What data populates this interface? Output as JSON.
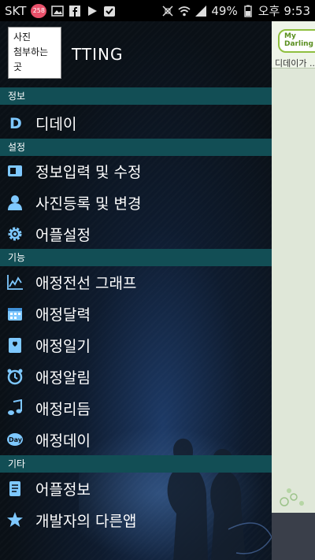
{
  "status_bar": {
    "carrier": "SKT",
    "notification_count": "258",
    "battery": "49%",
    "ampm": "오후",
    "time": "9:53"
  },
  "header": {
    "avatar_text_lines": [
      "사진",
      "첨부하는",
      "곳"
    ],
    "title": "TTING"
  },
  "sections": {
    "info": "정보",
    "settings": "설정",
    "features": "기능",
    "etc": "기타"
  },
  "items": {
    "dday": "디데이",
    "edit_info": "정보입력 및 수정",
    "photo": "사진등록 및 변경",
    "app_settings": "어플설정",
    "graph": "애정전선 그래프",
    "calendar": "애정달력",
    "diary": "애정일기",
    "alarm": "애정알림",
    "rhythm": "애정리듬",
    "day": "애정데이",
    "app_info": "어플정보",
    "other_apps": "개발자의 다른앱"
  },
  "background_app": {
    "logo": "My Darling",
    "text": "디데이가 ..."
  },
  "colors": {
    "section_bar": "#124e55",
    "icon_blue": "#7ec8ff",
    "drawer_bg": "#0a1016"
  }
}
